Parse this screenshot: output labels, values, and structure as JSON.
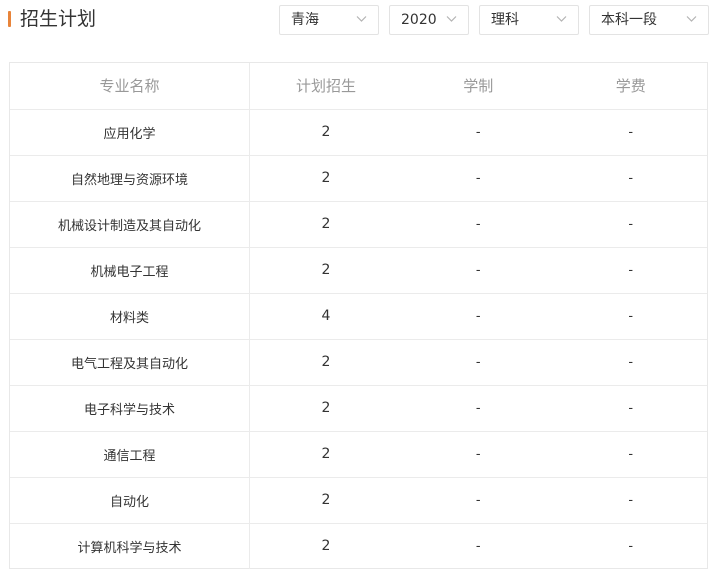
{
  "header": {
    "title": "招生计划"
  },
  "filters": {
    "province": "青海",
    "year": "2020",
    "subject": "理科",
    "batch": "本科一段"
  },
  "table": {
    "columns": [
      "专业名称",
      "计划招生",
      "学制",
      "学费"
    ],
    "rows": [
      [
        "应用化学",
        "2",
        "-",
        "-"
      ],
      [
        "自然地理与资源环境",
        "2",
        "-",
        "-"
      ],
      [
        "机械设计制造及其自动化",
        "2",
        "-",
        "-"
      ],
      [
        "机械电子工程",
        "2",
        "-",
        "-"
      ],
      [
        "材料类",
        "4",
        "-",
        "-"
      ],
      [
        "电气工程及其自动化",
        "2",
        "-",
        "-"
      ],
      [
        "电子科学与技术",
        "2",
        "-",
        "-"
      ],
      [
        "通信工程",
        "2",
        "-",
        "-"
      ],
      [
        "自动化",
        "2",
        "-",
        "-"
      ],
      [
        "计算机科学与技术",
        "2",
        "-",
        "-"
      ]
    ]
  },
  "colors": {
    "accent": "#e8843a",
    "header_text": "#999999",
    "border": "#ebebeb"
  }
}
